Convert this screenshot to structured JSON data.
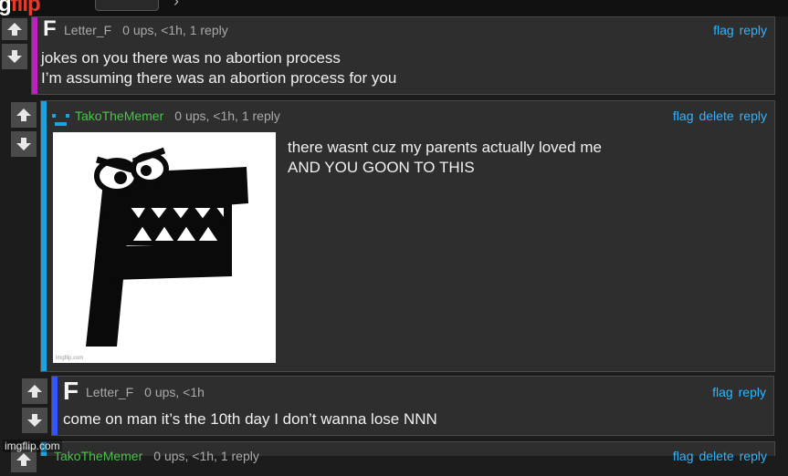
{
  "header": {
    "logo_left": "g",
    "logo_right": "flip",
    "nav_chevron": "›"
  },
  "comments": [
    {
      "username": "Letter_F",
      "stats": "0 ups, <1h, 1 reply",
      "actions": [
        "flag",
        "reply"
      ],
      "lines": [
        "jokes on you there was no abortion process",
        "I’m assuming there was an abortion process for you"
      ],
      "accent": "#c020c0"
    },
    {
      "username": "TakoTheMemer",
      "stats": "0 ups, <1h, 1 reply",
      "actions": [
        "flag",
        "delete",
        "reply"
      ],
      "lines": [
        "there wasnt cuz my parents actually loved me",
        "AND YOU GOON TO THIS"
      ],
      "image_watermark": "imgflip.com",
      "accent": "#1aa3e0"
    },
    {
      "username": "Letter_F",
      "stats": "0 ups, <1h",
      "actions": [
        "flag",
        "reply"
      ],
      "lines": [
        "come on man it’s the 10th day I don’t wanna lose NNN"
      ],
      "accent": "#3355ff"
    },
    {
      "username": "TakoTheMemer",
      "stats": "0 ups, <1h, 1 reply",
      "actions": [
        "flag",
        "delete",
        "reply"
      ]
    }
  ],
  "avatar_letter": "F",
  "watermark": "imgflip.com",
  "colors": {
    "background": "#1c1c1c",
    "card": "#2e2e2e",
    "link": "#2fb5ff",
    "username_green": "#4cc24c"
  }
}
